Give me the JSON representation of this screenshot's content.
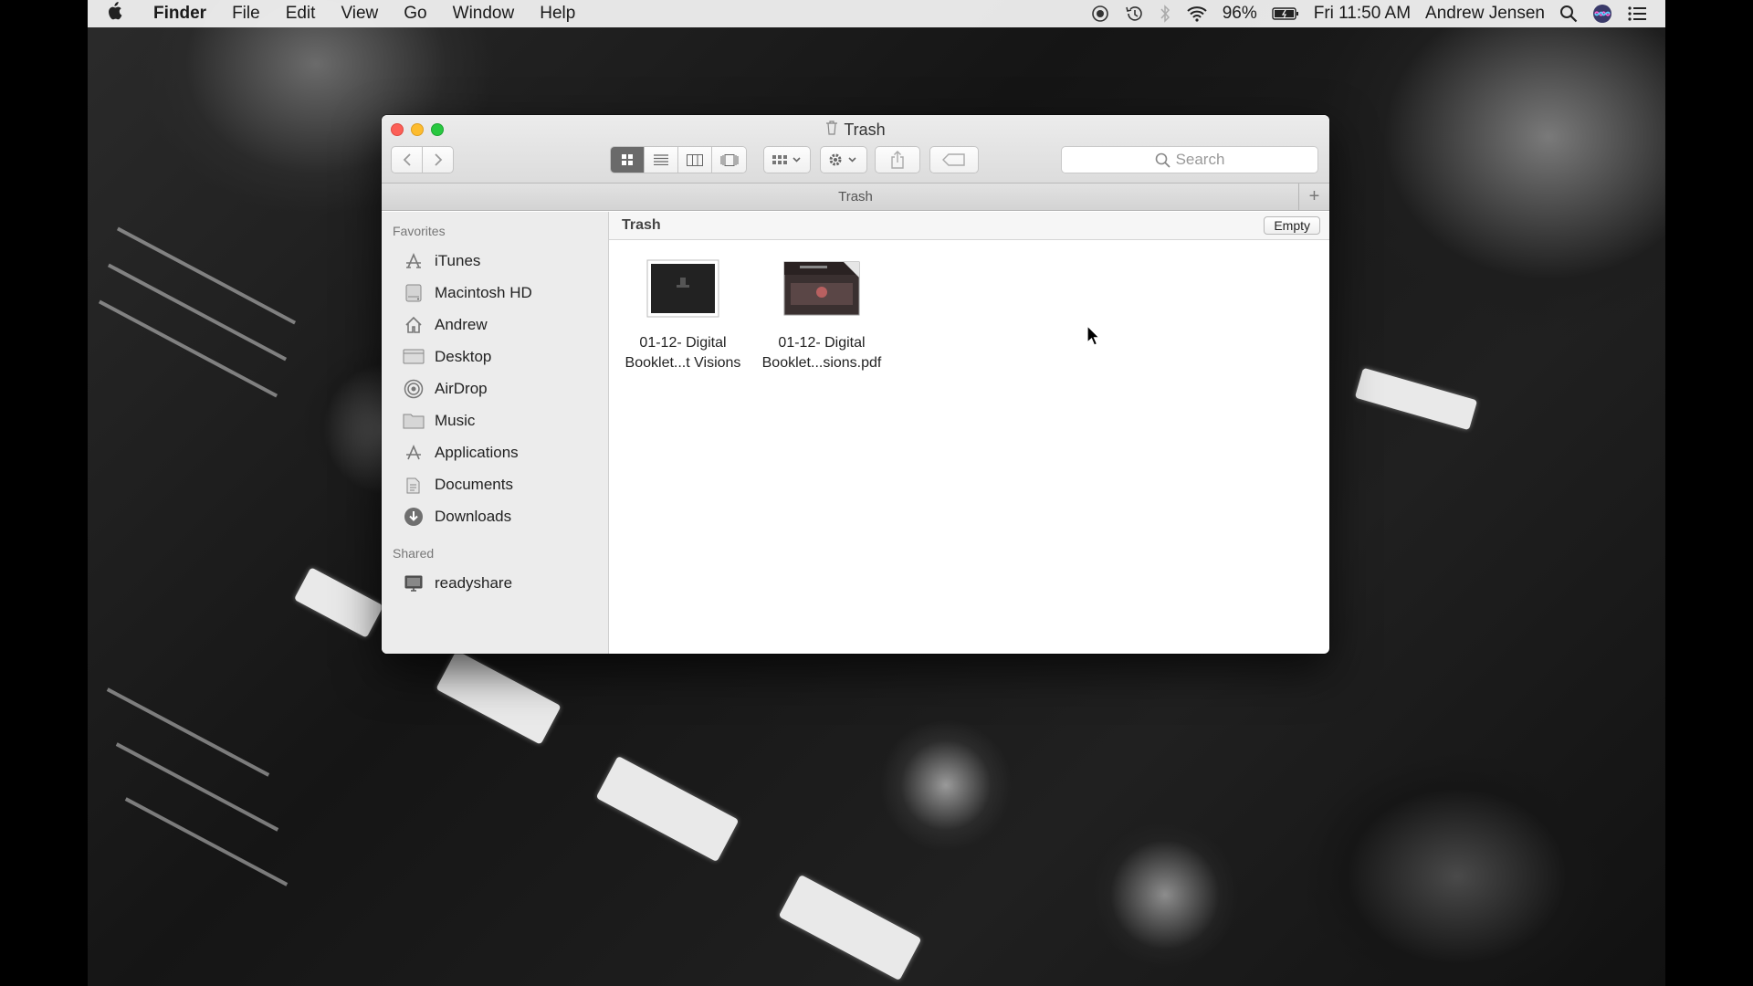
{
  "menubar": {
    "app_name": "Finder",
    "menus": [
      "File",
      "Edit",
      "View",
      "Go",
      "Window",
      "Help"
    ],
    "battery": "96%",
    "clock": "Fri 11:50 AM",
    "user": "Andrew Jensen"
  },
  "window": {
    "title": "Trash",
    "path_title": "Trash",
    "search_placeholder": "Search",
    "content_title": "Trash",
    "empty_button": "Empty"
  },
  "sidebar": {
    "favorites_header": "Favorites",
    "favorites": [
      {
        "label": "iTunes",
        "icon": "app-store-icon"
      },
      {
        "label": "Macintosh HD",
        "icon": "hard-drive-icon"
      },
      {
        "label": "Andrew",
        "icon": "home-icon"
      },
      {
        "label": "Desktop",
        "icon": "desktop-icon"
      },
      {
        "label": "AirDrop",
        "icon": "airdrop-icon"
      },
      {
        "label": "Music",
        "icon": "folder-icon"
      },
      {
        "label": "Applications",
        "icon": "applications-icon"
      },
      {
        "label": "Documents",
        "icon": "documents-icon"
      },
      {
        "label": "Downloads",
        "icon": "downloads-icon"
      }
    ],
    "shared_header": "Shared",
    "shared": [
      {
        "label": "readyshare",
        "icon": "monitor-icon"
      }
    ]
  },
  "files": [
    {
      "line1": "01-12- Digital",
      "line2": "Booklet...t Visions"
    },
    {
      "line1": "01-12- Digital",
      "line2": "Booklet...sions.pdf"
    }
  ],
  "colors": {
    "close": "#fc5f57",
    "minimize": "#fdbc2e",
    "zoom": "#28c840"
  }
}
